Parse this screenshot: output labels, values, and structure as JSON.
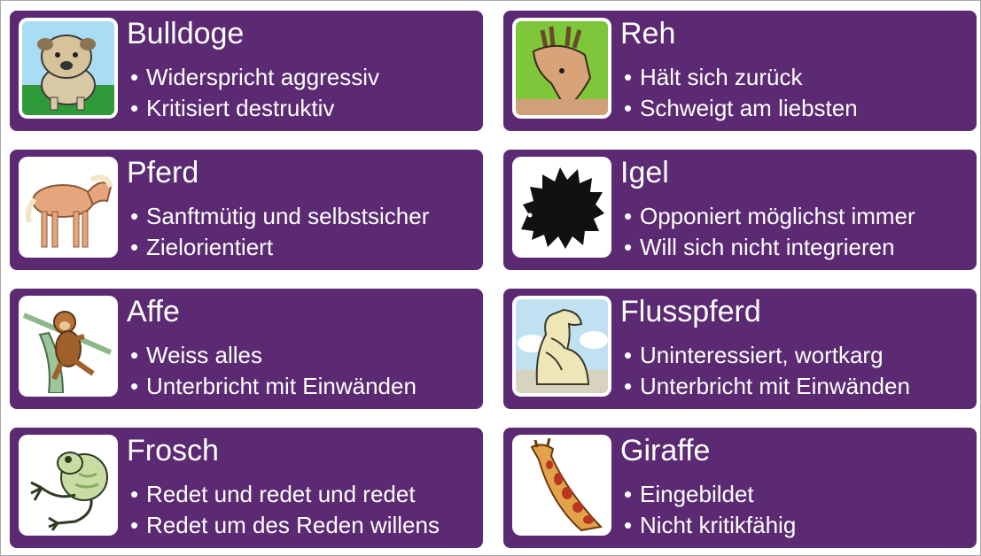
{
  "animals": [
    {
      "name": "Bulldoge",
      "traits": [
        "Widerspricht aggressiv",
        "Kritisiert destruktiv"
      ]
    },
    {
      "name": "Reh",
      "traits": [
        "Hält sich zurück",
        "Schweigt am liebsten"
      ]
    },
    {
      "name": "Pferd",
      "traits": [
        "Sanftmütig und selbstsicher",
        "Zielorientiert"
      ]
    },
    {
      "name": "Igel",
      "traits": [
        "Opponiert möglichst immer",
        "Will sich nicht integrieren"
      ]
    },
    {
      "name": "Affe",
      "traits": [
        "Weiss alles",
        "Unterbricht mit Einwänden"
      ]
    },
    {
      "name": "Flusspferd",
      "traits": [
        "Uninteressiert, wortkarg",
        "Unterbricht mit Einwänden"
      ]
    },
    {
      "name": "Frosch",
      "traits": [
        "Redet und redet und redet",
        "Redet um des Reden willens"
      ]
    },
    {
      "name": "Giraffe",
      "traits": [
        "Eingebildet",
        "Nicht kritikfähig"
      ]
    }
  ],
  "icons": [
    "bulldog-icon",
    "deer-icon",
    "horse-icon",
    "hedgehog-icon",
    "monkey-icon",
    "hippo-icon",
    "frog-icon",
    "giraffe-icon"
  ],
  "colors": {
    "card_background": "#5b2a72",
    "text": "#ffffff",
    "image_border": "#ffffff"
  }
}
